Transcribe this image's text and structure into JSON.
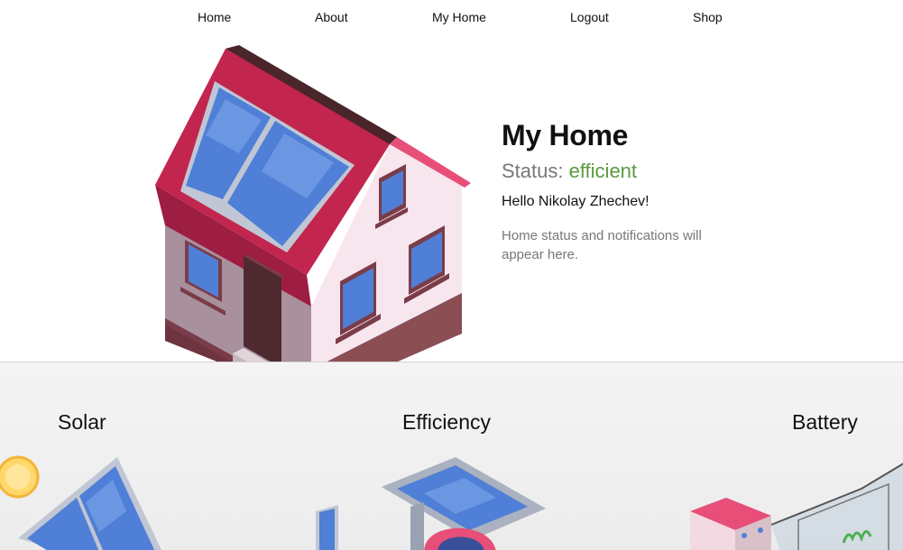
{
  "nav": {
    "items": [
      {
        "label": "Home",
        "name": "nav-home"
      },
      {
        "label": "About",
        "name": "nav-about"
      },
      {
        "label": "My Home",
        "name": "nav-my-home"
      },
      {
        "label": "Logout",
        "name": "nav-logout"
      },
      {
        "label": "Shop",
        "name": "nav-shop"
      }
    ]
  },
  "home": {
    "title": "My Home",
    "status_label": "Status:",
    "status_value": "efficient",
    "greeting": "Hello Nikolay Zhechev!",
    "note": "Home status and notifications will appear here."
  },
  "sections": {
    "solar": "Solar",
    "efficiency": "Efficiency",
    "battery": "Battery"
  },
  "colors": {
    "status_good": "#5a9a3e",
    "roof": "#c2254e",
    "wall": "#f8e6ef",
    "panel": "#4f7fd6"
  }
}
